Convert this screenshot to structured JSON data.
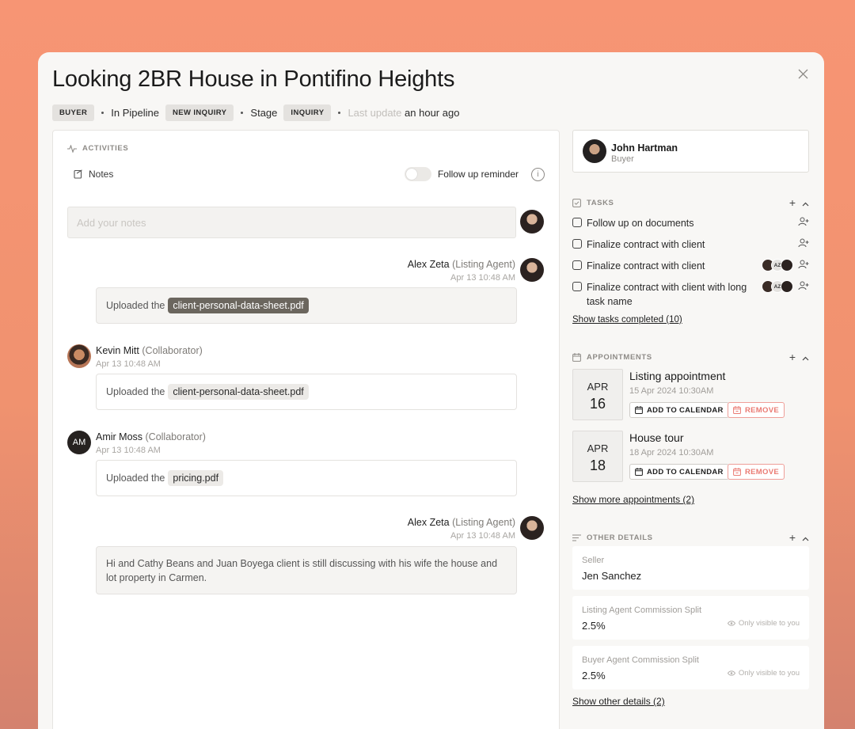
{
  "header": {
    "title": "Looking 2BR House in Pontifino Heights",
    "role_badge": "BUYER",
    "pipeline_label": "In Pipeline",
    "pipeline_badge": "NEW INQUIRY",
    "stage_label": "Stage",
    "stage_badge": "INQUIRY",
    "last_update_label": "Last update",
    "last_update_value": "an hour ago"
  },
  "activities": {
    "section_label": "ACTIVITIES",
    "notes_tab": "Notes",
    "follow_up_label": "Follow up reminder",
    "follow_up_enabled": false,
    "notes_placeholder": "Add your notes",
    "entries": [
      {
        "name": "Alex Zeta",
        "role": "(Listing Agent)",
        "time": "Apr 13 10:48 AM",
        "text": "Uploaded the",
        "file": "client-personal-data-sheet.pdf"
      },
      {
        "name": "Kevin Mitt",
        "role": "(Collaborator)",
        "time": "Apr 13 10:48 AM",
        "text": "Uploaded the",
        "file": "client-personal-data-sheet.pdf"
      },
      {
        "name": "Amir Moss",
        "role": "(Collaborator)",
        "initials": "AM",
        "time": "Apr 13 10:48 AM",
        "text": "Uploaded the",
        "file": "pricing.pdf"
      },
      {
        "name": "Alex Zeta",
        "role": "(Listing Agent)",
        "time": "Apr 13 10:48 AM",
        "text": "Hi and Cathy Beans and Juan Boyega client is still discussing with his wife the house and lot property in Carmen."
      }
    ]
  },
  "contact": {
    "name": "John Hartman",
    "role": "Buyer"
  },
  "tasks": {
    "section_label": "TASKS",
    "items": [
      {
        "label": "Follow up on documents",
        "done": false
      },
      {
        "label": "Finalize contract with client",
        "done": false
      },
      {
        "label": "Finalize contract with client",
        "done": false,
        "assignee_initials": "AZ"
      },
      {
        "label": "Finalize contract with client with long task name",
        "done": false,
        "assignee_initials": "AZ"
      }
    ],
    "show_completed": "Show tasks completed (10)"
  },
  "appointments": {
    "section_label": "APPOINTMENTS",
    "add_to_calendar": "ADD TO CALENDAR",
    "remove": "REMOVE",
    "items": [
      {
        "month": "APR",
        "day": "16",
        "title": "Listing appointment",
        "datetime": "15 Apr 2024 10:30AM"
      },
      {
        "month": "APR",
        "day": "18",
        "title": "House tour",
        "datetime": "18 Apr 2024 10:30AM"
      }
    ],
    "show_more": "Show more appointments (2)"
  },
  "other_details": {
    "section_label": "OTHER DETAILS",
    "only_visible": "Only visible to you",
    "items": [
      {
        "label": "Seller",
        "value": "Jen Sanchez"
      },
      {
        "label": "Listing Agent Commission Split",
        "value": "2.5%"
      },
      {
        "label": "Buyer Agent Commission Split",
        "value": "2.5%"
      }
    ],
    "show_other": "Show other details (2)"
  },
  "colors": {
    "background": "#f79574",
    "panel": "#f8f7f5",
    "file_chip_dark": "#6b665e",
    "remove": "#ea7b73"
  }
}
